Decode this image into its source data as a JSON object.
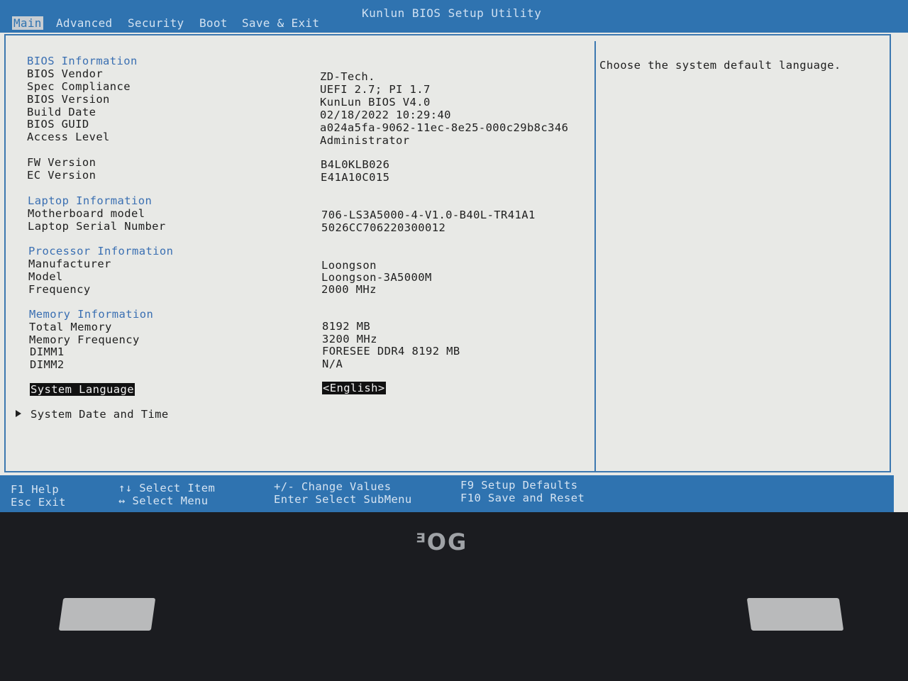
{
  "window": {
    "title": "Kunlun BIOS Setup Utility"
  },
  "tabs": [
    {
      "label": "Main",
      "active": true
    },
    {
      "label": "Advanced",
      "active": false
    },
    {
      "label": "Security",
      "active": false
    },
    {
      "label": "Boot",
      "active": false
    },
    {
      "label": "Save & Exit",
      "active": false
    }
  ],
  "bios": {
    "heading": "BIOS Information",
    "vendor_label": "BIOS Vendor",
    "vendor": "ZD-Tech.",
    "spec_label": "Spec Compliance",
    "spec": "UEFI 2.7; PI 1.7",
    "version_label": "BIOS Version",
    "version": "KunLun BIOS V4.0",
    "build_label": "Build Date",
    "build": "02/18/2022 10:29:40",
    "guid_label": "BIOS GUID",
    "guid": "a024a5fa-9062-11ec-8e25-000c29b8c346",
    "access_label": "Access Level",
    "access": "Administrator",
    "fw_label": "FW Version",
    "fw": "B4L0KLB026",
    "ec_label": "EC Version",
    "ec": "E41A10C015"
  },
  "laptop": {
    "heading": "Laptop Information",
    "mb_label": "Motherboard model",
    "mb": "706-LS3A5000-4-V1.0-B40L-TR41A1",
    "serial_label": "Laptop Serial Number",
    "serial": "5026CC706220300012"
  },
  "processor": {
    "heading": "Processor Information",
    "manu_label": "Manufacturer",
    "manu": "Loongson",
    "model_label": "Model",
    "model": "Loongson-3A5000M",
    "freq_label": "Frequency",
    "freq": "2000 MHz"
  },
  "memory": {
    "heading": "Memory Information",
    "total_label": "Total Memory",
    "total": "8192 MB",
    "freq_label": "Memory Frequency",
    "freq": "3200 MHz",
    "dimm1_label": "DIMM1",
    "dimm1": "FORESEE DDR4 8192 MB",
    "dimm2_label": "DIMM2",
    "dimm2": "N/A"
  },
  "settings": {
    "language_label": "System Language",
    "language_value": "<English>",
    "datetime_label": "System Date and Time"
  },
  "help": {
    "text": "Choose the system default language."
  },
  "footer": {
    "f1": "F1  Help",
    "esc": "Esc Exit",
    "arrows_ud": "↑↓  Select Item",
    "arrows_lr": "↔  Select Menu",
    "plusminus": "+/-   Change Values",
    "enter": "Enter Select SubMenu",
    "f9": "F9  Setup Defaults",
    "f10": "F10 Save and Reset"
  },
  "bezel": {
    "logo": "ᴲOG"
  }
}
